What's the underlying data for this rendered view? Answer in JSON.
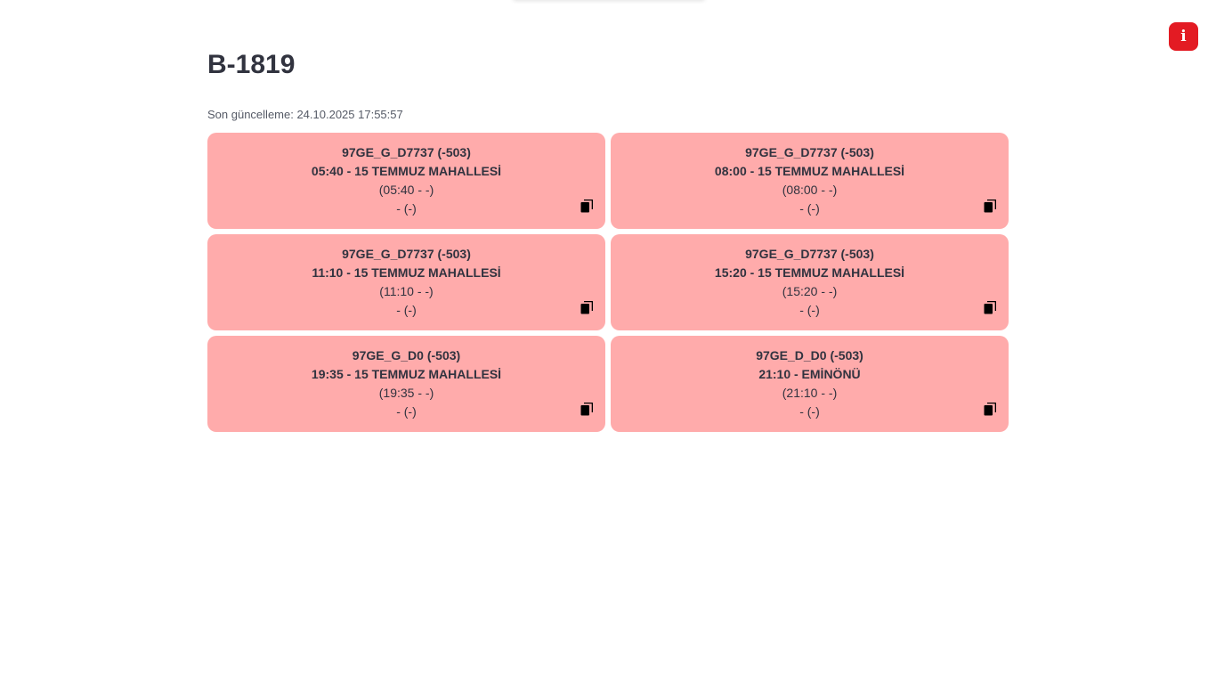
{
  "page": {
    "title": "B-1819",
    "last_updated": "Son güncelleme: 24.10.2025 17:55:57"
  },
  "info_button": {
    "label": "i",
    "color": "#e31b23"
  },
  "card_color": "#ffabab",
  "cards": [
    {
      "route": "97GE_G_D7737 (-503)",
      "departure": "05:40 - 15 TEMMUZ MAHALLESİ",
      "detail": "(05:40 - -)",
      "status": "- (-)",
      "icon": "copy-icon"
    },
    {
      "route": "97GE_G_D7737 (-503)",
      "departure": "08:00 - 15 TEMMUZ MAHALLESİ",
      "detail": "(08:00 - -)",
      "status": "- (-)",
      "icon": "copy-icon"
    },
    {
      "route": "97GE_G_D7737 (-503)",
      "departure": "11:10 - 15 TEMMUZ MAHALLESİ",
      "detail": "(11:10 - -)",
      "status": "- (-)",
      "icon": "copy-icon"
    },
    {
      "route": "97GE_G_D7737 (-503)",
      "departure": "15:20 - 15 TEMMUZ MAHALLESİ",
      "detail": "(15:20 - -)",
      "status": "- (-)",
      "icon": "copy-icon"
    },
    {
      "route": "97GE_G_D0 (-503)",
      "departure": "19:35 - 15 TEMMUZ MAHALLESİ",
      "detail": "(19:35 - -)",
      "status": "- (-)",
      "icon": "copy-icon"
    },
    {
      "route": "97GE_D_D0 (-503)",
      "departure": "21:10 - EMİNÖNÜ",
      "detail": "(21:10 - -)",
      "status": "- (-)",
      "icon": "copy-icon"
    }
  ]
}
